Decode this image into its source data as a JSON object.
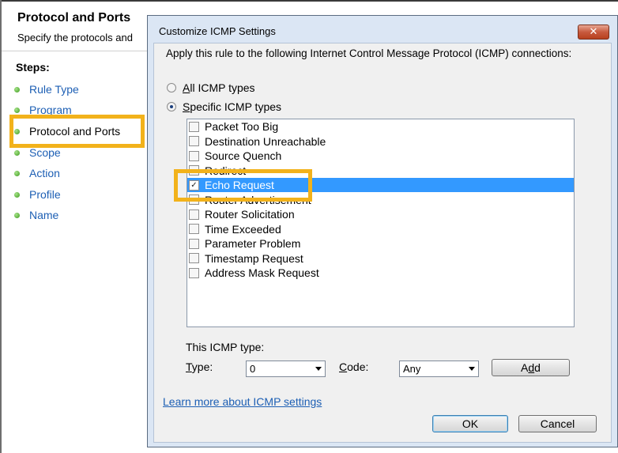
{
  "wizard": {
    "title": "Protocol and Ports",
    "subtitle": "Specify the protocols and",
    "steps_heading": "Steps:",
    "steps": [
      {
        "label": "Rule Type"
      },
      {
        "label": "Program"
      },
      {
        "label": "Protocol and Ports"
      },
      {
        "label": "Scope"
      },
      {
        "label": "Action"
      },
      {
        "label": "Profile"
      },
      {
        "label": "Name"
      }
    ],
    "current_step": "Protocol and Ports"
  },
  "dialog": {
    "title": "Customize ICMP Settings",
    "close_glyph": "✕",
    "intro": "Apply this rule to the following Internet Control Message Protocol (ICMP) connections:",
    "radio_all": {
      "pre": "",
      "mn": "A",
      "post": "ll ICMP types",
      "checked": false
    },
    "radio_specific": {
      "pre": "",
      "mn": "S",
      "post": "pecific ICMP types",
      "checked": true
    },
    "icmp_types": [
      {
        "label": "Packet Too Big",
        "checked": false
      },
      {
        "label": "Destination Unreachable",
        "checked": false
      },
      {
        "label": "Source Quench",
        "checked": false
      },
      {
        "label": "Redirect",
        "checked": false
      },
      {
        "label": "Echo Request",
        "checked": true,
        "selected": true
      },
      {
        "label": "Router Advertisement",
        "checked": false
      },
      {
        "label": "Router Solicitation",
        "checked": false
      },
      {
        "label": "Time Exceeded",
        "checked": false
      },
      {
        "label": "Parameter Problem",
        "checked": false
      },
      {
        "label": "Timestamp Request",
        "checked": false
      },
      {
        "label": "Address Mask Request",
        "checked": false
      }
    ],
    "this_type_label": "This ICMP type:",
    "type_label": {
      "mn": "T",
      "post": "ype:"
    },
    "type_value": "0",
    "code_label": {
      "mn": "C",
      "post": "ode:"
    },
    "code_value": "Any",
    "add_button": {
      "pre": "A",
      "mn": "d",
      "post": "d"
    },
    "learn_more_link": "Learn more about ICMP settings",
    "ok_button": "OK",
    "cancel_button": "Cancel"
  },
  "colors": {
    "highlight_box": "#f2b21b",
    "selection": "#3399ff",
    "link": "#1d5fb4"
  }
}
